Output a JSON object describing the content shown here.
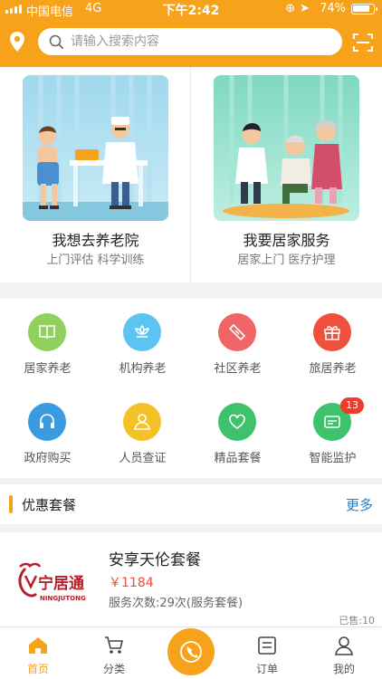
{
  "status_bar": {
    "carrier": "中国电信",
    "network": "4G",
    "time": "下午2:42",
    "battery": "74%"
  },
  "search": {
    "placeholder": "请输入搜索内容"
  },
  "feature_cards": [
    {
      "title": "我想去养老院",
      "subtitle": "上门评估 科学训练"
    },
    {
      "title": "我要居家服务",
      "subtitle": "居家上门 医疗护理"
    }
  ],
  "categories": [
    {
      "label": "居家养老",
      "icon": "book-icon",
      "color": "#8fd15c"
    },
    {
      "label": "机构养老",
      "icon": "lotus-icon",
      "color": "#5bc4f0"
    },
    {
      "label": "社区养老",
      "icon": "ticket-icon",
      "color": "#f06666"
    },
    {
      "label": "旅居养老",
      "icon": "gift-icon",
      "color": "#f0513d"
    },
    {
      "label": "政府购买",
      "icon": "headset-icon",
      "color": "#3b9be0"
    },
    {
      "label": "人员查证",
      "icon": "person-icon",
      "color": "#f5c226"
    },
    {
      "label": "精品套餐",
      "icon": "heart-icon",
      "color": "#3ec26b"
    },
    {
      "label": "智能监护",
      "icon": "card-icon",
      "color": "#3ec26b",
      "badge": "13"
    }
  ],
  "section": {
    "title": "优惠套餐",
    "more": "更多"
  },
  "package": {
    "name": "安享天伦套餐",
    "price": "￥1184",
    "service_times": "服务次数:29次(服务套餐)",
    "sold": "已售:10",
    "logo_text": "宁居通",
    "logo_sub": "NINGJUTONG"
  },
  "tabbar": {
    "home": "首页",
    "category": "分类",
    "orders": "订单",
    "mine": "我的"
  },
  "colors": {
    "brand": "#f7a21b",
    "price": "#ef4c3c",
    "link": "#1f82d1"
  }
}
